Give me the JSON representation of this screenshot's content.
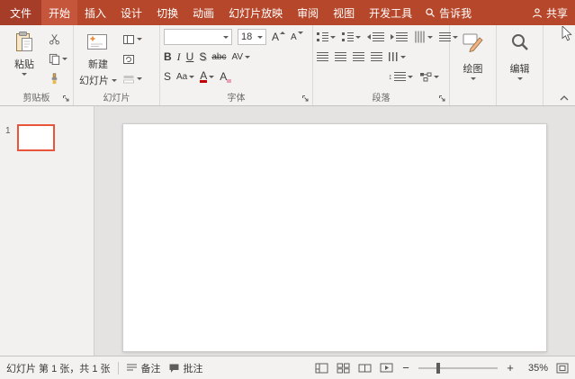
{
  "menubar": {
    "file_tab": "文件",
    "tabs": [
      "开始",
      "插入",
      "设计",
      "切换",
      "动画",
      "幻灯片放映",
      "审阅",
      "视图",
      "开发工具"
    ],
    "active_tab": "开始",
    "tell_me": "告诉我",
    "share": "共享"
  },
  "ribbon": {
    "clipboard": {
      "group_label": "剪贴板",
      "paste_label": "粘贴"
    },
    "slides": {
      "group_label": "幻灯片",
      "new_slide_line1": "新建",
      "new_slide_line2": "幻灯片"
    },
    "font": {
      "group_label": "字体",
      "font_name_value": "",
      "font_size_value": "18",
      "bold": "B",
      "italic": "I",
      "underline": "U",
      "text_shadow": "S",
      "strikethrough": "abc",
      "char_spacing": "AV",
      "grow_font": "A",
      "shrink_font": "A",
      "font_color": "A",
      "change_case": "Aa",
      "clear_formatting": "A"
    },
    "paragraph": {
      "group_label": "段落",
      "line_spacing_glyph": "↕"
    },
    "drawing": {
      "button_label": "绘图"
    },
    "editing": {
      "button_label": "编辑"
    }
  },
  "slides_panel": {
    "slide_number": "1"
  },
  "statusbar": {
    "slide_info": "幻灯片 第 1 张，共 1 张",
    "notes_label": "备注",
    "comments_label": "批注",
    "zoom_minus": "−",
    "zoom_plus": "+",
    "zoom_level": "35%"
  },
  "colors": {
    "titlebar": "#B7472A",
    "file_tab_bg": "#A53D28",
    "active_tab_bg": "#C5553B",
    "ribbon_bg": "#F3F2F1",
    "selected_thumbnail_border": "#E8553B",
    "editor_bg": "#E5E3E2"
  }
}
